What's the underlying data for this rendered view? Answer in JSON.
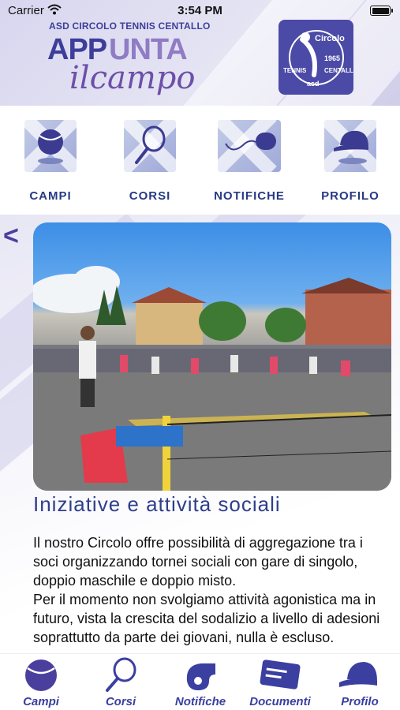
{
  "status_bar": {
    "carrier": "Carrier",
    "time": "3:54 PM"
  },
  "header": {
    "club_name": "ASD CIRCOLO TENNIS CENTALLO",
    "app_name_part1": "APP",
    "app_name_part2": "UNTA",
    "app_name_part3": "ilcampo",
    "logo": {
      "top": "Circolo",
      "year": "1965",
      "left": "TENNIS",
      "right": "CENTALLO",
      "bottom": "asd"
    }
  },
  "quick_menu": [
    {
      "label": "CAMPI",
      "icon": "tennis-ball-icon"
    },
    {
      "label": "CORSI",
      "icon": "tennis-racket-icon"
    },
    {
      "label": "NOTIFICHE",
      "icon": "whistle-icon"
    },
    {
      "label": "PROFILO",
      "icon": "cap-icon"
    }
  ],
  "content": {
    "back_symbol": "<",
    "title": "Iniziative e attività sociali",
    "body": "Il nostro Circolo offre possibilità di aggregazione tra i soci organizzando tornei sociali con gare di singolo, doppio maschile e doppio misto.\nPer il momento non svolgiamo attività agonistica ma in futuro, vista la crescita del sodalizio a livello di adesioni soprattutto da parte dei giovani, nulla è escluso."
  },
  "tab_bar": [
    {
      "label": "Campi",
      "icon": "tennis-ball-icon"
    },
    {
      "label": "Corsi",
      "icon": "tennis-racket-icon"
    },
    {
      "label": "Notifiche",
      "icon": "whistle-icon"
    },
    {
      "label": "Documenti",
      "icon": "id-card-icon"
    },
    {
      "label": "Profilo",
      "icon": "cap-icon"
    }
  ],
  "colors": {
    "brand": "#3d3e9a",
    "accent": "#8f7cc4",
    "label": "#263a84"
  }
}
